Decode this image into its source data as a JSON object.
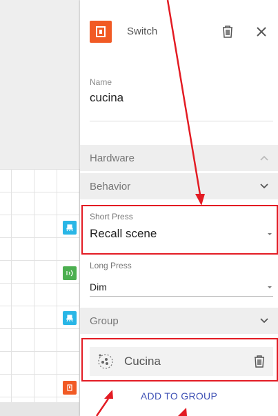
{
  "header": {
    "type_label": "Switch"
  },
  "name": {
    "label": "Name",
    "value": "cucina"
  },
  "sections": {
    "hardware": "Hardware",
    "behavior": "Behavior",
    "group": "Group"
  },
  "short_press": {
    "label": "Short Press",
    "value": "Recall scene"
  },
  "long_press": {
    "label": "Long Press",
    "value": "Dim"
  },
  "group_item": {
    "name": "Cucina"
  },
  "add_to_group": "ADD TO GROUP",
  "colors": {
    "accent": "#3f51b5",
    "switch_orange": "#f15a24",
    "highlight_red": "#e31b23",
    "node_blue": "#29b6e6",
    "node_green": "#4caf50"
  },
  "icons": [
    "switch-icon",
    "trash-icon",
    "close-icon",
    "chevron-up-icon",
    "chevron-down-icon",
    "dropdown-arrow-icon",
    "group-dots-icon",
    "light-icon",
    "sensor-icon"
  ]
}
